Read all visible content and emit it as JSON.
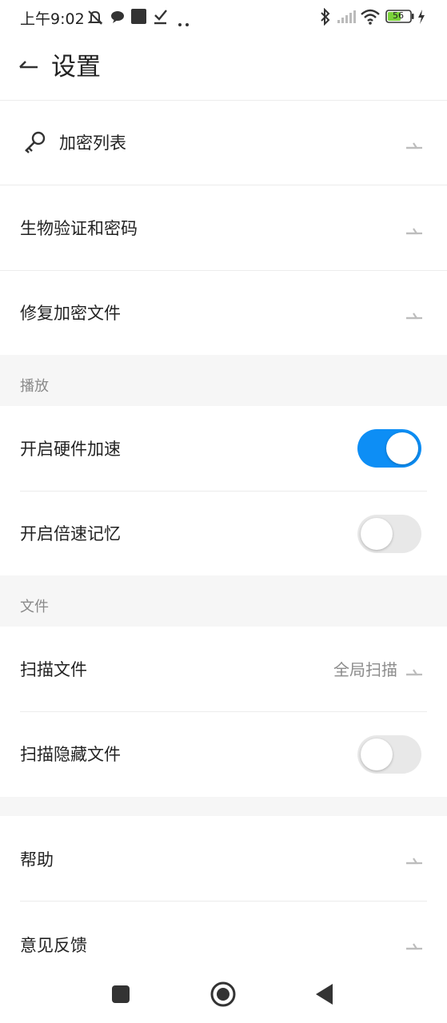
{
  "status_bar": {
    "time": "上午9:02",
    "battery_level": "56",
    "icons": [
      "mute-bell-icon",
      "chat-bubble-icon",
      "app-square-icon",
      "check-icon",
      "more-dots-icon",
      "bluetooth-icon",
      "signal-icon",
      "wifi-icon",
      "battery-icon",
      "charging-icon"
    ]
  },
  "header": {
    "title": "设置",
    "back_icon": "back-arrow-icon"
  },
  "rows_top": [
    {
      "label": "加密列表",
      "icon": "key-icon"
    },
    {
      "label": "生物验证和密码"
    },
    {
      "label": "修复加密文件"
    }
  ],
  "section_playback": {
    "title": "播放",
    "items": [
      {
        "label": "开启硬件加速",
        "toggle": true
      },
      {
        "label": "开启倍速记忆",
        "toggle": false
      }
    ]
  },
  "section_files": {
    "title": "文件",
    "items": [
      {
        "label": "扫描文件",
        "value": "全局扫描"
      },
      {
        "label": "扫描隐藏文件",
        "toggle": false
      }
    ]
  },
  "rows_bottom": [
    {
      "label": "帮助"
    },
    {
      "label": "意见反馈"
    }
  ],
  "colors": {
    "accent": "#0d8ef5",
    "section_bg": "#f6f6f6",
    "muted_text": "#8a8a8a"
  },
  "nav_bar": {
    "icons": [
      "recent-apps-icon",
      "home-icon",
      "back-icon"
    ]
  }
}
